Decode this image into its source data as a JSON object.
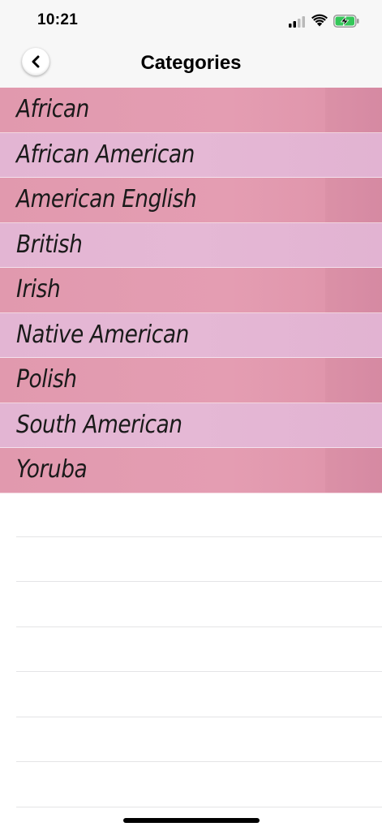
{
  "status_bar": {
    "time": "10:21",
    "signal_icon": "cellular-signal-icon",
    "wifi_icon": "wifi-icon",
    "battery_icon": "battery-charging-icon",
    "battery_color": "#34c759"
  },
  "nav": {
    "title": "Categories",
    "back_icon": "chevron-left-icon"
  },
  "categories": [
    {
      "label": "African"
    },
    {
      "label": "African American"
    },
    {
      "label": "American English"
    },
    {
      "label": "British"
    },
    {
      "label": "Irish"
    },
    {
      "label": "Native American"
    },
    {
      "label": "Polish"
    },
    {
      "label": "South American"
    },
    {
      "label": "Yoruba"
    }
  ],
  "colors": {
    "row_dark": "#e199ae",
    "row_light": "#e3b5d3",
    "nav_background": "#f7f7f7"
  }
}
